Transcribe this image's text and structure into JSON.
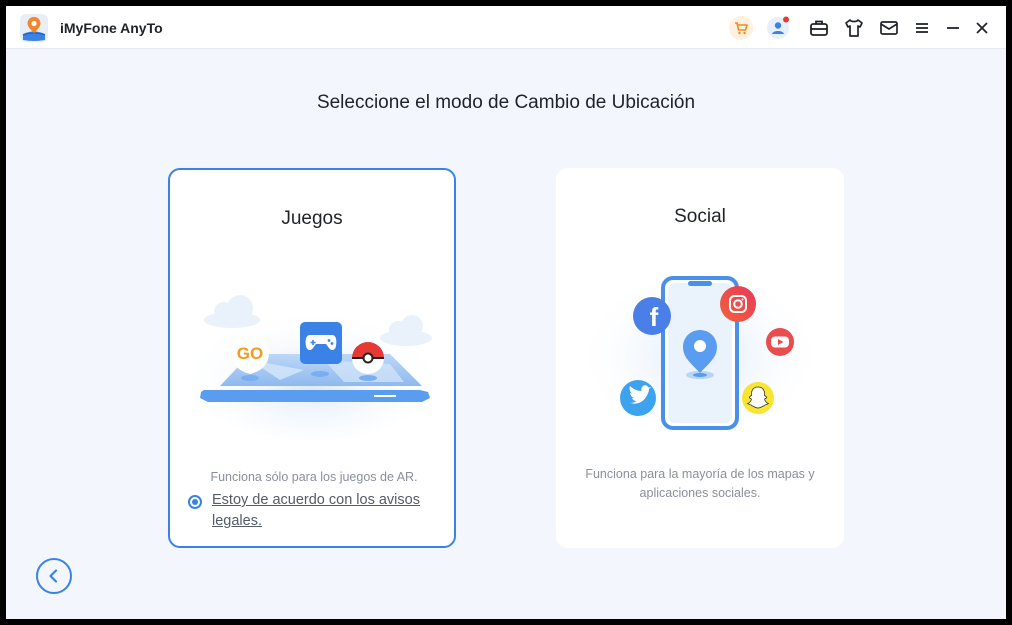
{
  "app": {
    "title": "iMyFone AnyTo"
  },
  "toolbar": {
    "icons": [
      "shop-cart-icon",
      "account-icon",
      "toolbox-icon",
      "theme-shirt-icon",
      "mail-icon",
      "menu-icon",
      "minimize-icon",
      "close-icon"
    ],
    "account_badge_color": "#e53935",
    "cart_bg_color": "#fff1dd"
  },
  "main": {
    "heading": "Seleccione el modo de Cambio de Ubicación",
    "modes": [
      {
        "title": "Juegos",
        "description": "Funciona sólo para los juegos de AR.",
        "agreement": "Estoy de acuerdo con los avisos legales.",
        "agreement_checked": true,
        "selected": true,
        "illustration_labels": [
          "GO"
        ]
      },
      {
        "title": "Social",
        "description": "Funciona para la mayoría de los mapas y aplicaciones sociales.",
        "selected": false,
        "illustration_labels": [
          "f"
        ]
      }
    ]
  },
  "colors": {
    "accent": "#3a82e6",
    "background": "#f3f7fd"
  },
  "nav": {
    "back_icon": "back-arrow-icon"
  }
}
